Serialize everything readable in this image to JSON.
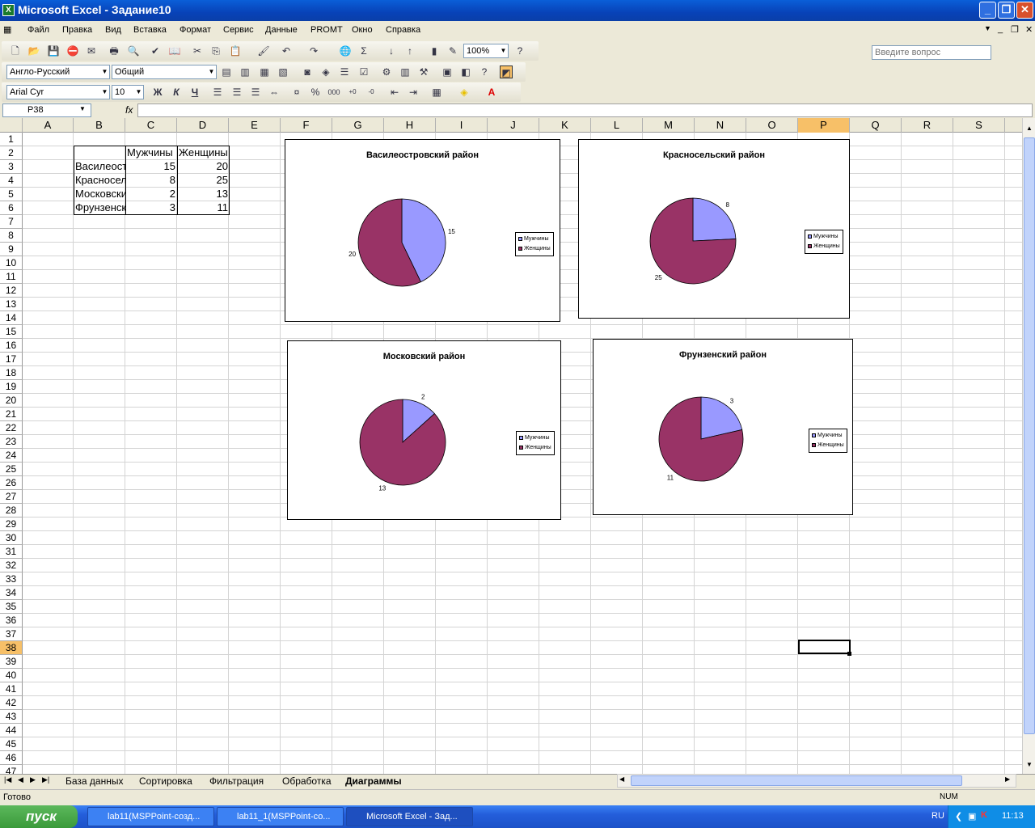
{
  "title": "Microsoft Excel - Задание10",
  "menu": [
    "Файл",
    "Правка",
    "Вид",
    "Вставка",
    "Формат",
    "Сервис",
    "Данные",
    "PROMT",
    "Окно",
    "Справка"
  ],
  "ask_placeholder": "Введите вопрос",
  "zoom": "100%",
  "translator_dir": "Англо-Русский",
  "translator_style": "Общий",
  "font_name": "Arial Cyr",
  "font_size": "10",
  "name_box": "P38",
  "fx": "fx",
  "columns": [
    "A",
    "B",
    "C",
    "D",
    "E",
    "F",
    "G",
    "H",
    "I",
    "J",
    "K",
    "L",
    "M",
    "N",
    "O",
    "P",
    "Q",
    "R",
    "S"
  ],
  "rows": [
    "1",
    "2",
    "3",
    "4",
    "5",
    "6",
    "7",
    "8",
    "9",
    "10",
    "11",
    "12",
    "13",
    "14",
    "15",
    "16",
    "17",
    "18",
    "19",
    "20",
    "21",
    "22",
    "23",
    "24",
    "25",
    "26",
    "27",
    "28",
    "29",
    "30",
    "31",
    "32",
    "33",
    "34",
    "35",
    "36",
    "37",
    "38",
    "39",
    "40",
    "41",
    "42",
    "43",
    "44",
    "45",
    "46",
    "47"
  ],
  "table": {
    "headers": [
      "Мужчины",
      "Женщины"
    ],
    "rows": [
      {
        "label": "Василеостровский район",
        "men": "15",
        "women": "20"
      },
      {
        "label": "Красносельский район",
        "men": "8",
        "women": "25"
      },
      {
        "label": "Московский район",
        "men": "2",
        "women": "13"
      },
      {
        "label": "Фрунзенский район",
        "men": "3",
        "women": "11"
      }
    ]
  },
  "legend": {
    "men": "Мужчины",
    "women": "Женщины"
  },
  "colors": {
    "men": "#9999ff",
    "women": "#993366",
    "selection": "#f7c068"
  },
  "chart_data": [
    {
      "type": "pie",
      "title": "Василеостровский район",
      "categories": [
        "Мужчины",
        "Женщины"
      ],
      "values": [
        15,
        20
      ]
    },
    {
      "type": "pie",
      "title": "Красносельский район",
      "categories": [
        "Мужчины",
        "Женщины"
      ],
      "values": [
        8,
        25
      ]
    },
    {
      "type": "pie",
      "title": "Московский район",
      "categories": [
        "Мужчины",
        "Женщины"
      ],
      "values": [
        2,
        13
      ]
    },
    {
      "type": "pie",
      "title": "Фрунзенский район",
      "categories": [
        "Мужчины",
        "Женщины"
      ],
      "values": [
        3,
        11
      ]
    }
  ],
  "sheets": [
    "База данных",
    "Сортировка",
    "Фильтрация",
    "Обработка",
    "Диаграммы"
  ],
  "status": {
    "ready": "Готово",
    "num": "NUM"
  },
  "taskbar": {
    "start": "пуск",
    "tasks": [
      "lab11(MSPPoint-созд...",
      "lab11_1(MSPPoint-со...",
      "Microsoft Excel - Зад..."
    ],
    "lang": "RU",
    "clock": "11:13"
  }
}
